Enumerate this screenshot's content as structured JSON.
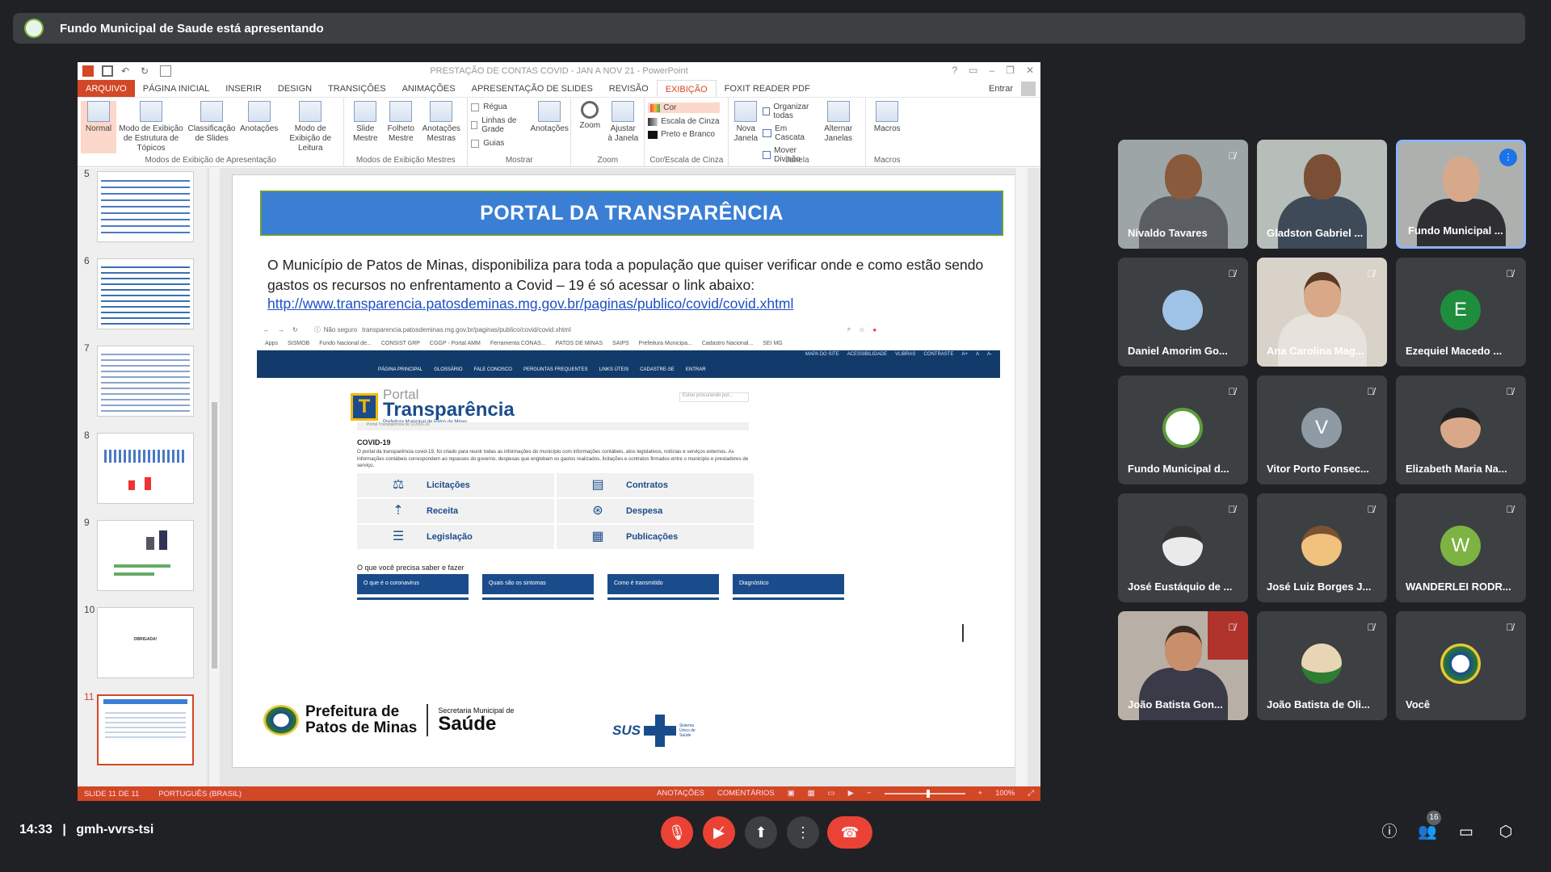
{
  "presenting": {
    "text": "Fundo Municipal de Saude está apresentando"
  },
  "ppt": {
    "window_title": "PRESTAÇÃO DE CONTAS COVID - JAN A NOV 21 - PowerPoint",
    "window_controls": [
      "?",
      "▭",
      "–",
      "❐",
      "✕"
    ],
    "signin": "Entrar",
    "tabs": [
      "ARQUIVO",
      "PÁGINA INICIAL",
      "INSERIR",
      "DESIGN",
      "TRANSIÇÕES",
      "ANIMAÇÕES",
      "APRESENTAÇÃO DE SLIDES",
      "REVISÃO",
      "EXIBIÇÃO",
      "FOXIT READER PDF"
    ],
    "ribbon": {
      "views": [
        "Normal",
        "Modo de Exibição de Estrutura de Tópicos",
        "Classificação de Slides",
        "Anotações",
        "Modo de Exibição de Leitura"
      ],
      "views_label": "Modos de Exibição de Apresentação",
      "masters": [
        "Slide Mestre",
        "Folheto Mestre",
        "Anotações Mestras"
      ],
      "masters_label": "Modos de Exibição Mestres",
      "show": [
        "Régua",
        "Linhas de Grade",
        "Guias"
      ],
      "show_notes": "Anotações",
      "show_label": "Mostrar",
      "zoom": [
        "Zoom",
        "Ajustar à Janela"
      ],
      "zoom_label": "Zoom",
      "color": [
        "Cor",
        "Escala de Cinza",
        "Preto e Branco"
      ],
      "color_label": "Cor/Escala de Cinza",
      "window_new": "Nova Janela",
      "window_opts": [
        "Organizar todas",
        "Em Cascata",
        "Mover Divisão"
      ],
      "window_switch": "Alternar Janelas",
      "window_label": "Janela",
      "macros": "Macros",
      "macros_label": "Macros"
    },
    "thumb_numbers": [
      "5",
      "6",
      "7",
      "8",
      "9",
      "10",
      "11"
    ],
    "thumb10_text": "OBRIGADA!",
    "status": {
      "slide": "SLIDE 11 DE 11",
      "lang": "PORTUGUÊS (BRASIL)",
      "notes": "ANOTAÇÕES",
      "comments": "COMENTÁRIOS",
      "zoom": "100%"
    }
  },
  "slide": {
    "title": "PORTAL DA TRANSPARÊNCIA",
    "text": "O Município de Patos de Minas, disponibiliza para toda a população que quiser verificar onde e como estão sendo gastos os recursos no enfrentamento a Covid – 19 é só acessar o link abaixo:",
    "link": "http://www.transparencia.patosdeminas.mg.gov.br/paginas/publico/covid/covid.xhtml",
    "browser": {
      "not_secure": "Não seguro",
      "url": "transparencia.patosdeminas.mg.gov.br/paginas/publico/covid/covid.xhtml",
      "bookmarks": [
        "Apps",
        "SISMOB",
        "Fundo Nacional de...",
        "CONSIST GRP",
        "CGGP - Portal AMM",
        "Ferramenta CONAS...",
        "PATOS DE MINAS",
        "SAIPS",
        "Prefeitura Municipa...",
        "Cadastro Nacional...",
        "SEI MG"
      ],
      "topnav_right": [
        "MAPA DO SITE",
        "ACESSIBILIDADE",
        "VLIBRAS",
        "CONTRASTE",
        "A+",
        "A",
        "A-"
      ],
      "topnav": [
        "PÁGINA PRINCIPAL",
        "GLOSSÁRIO",
        "FALE CONOSCO",
        "PERGUNTAS FREQUENTES",
        "LINKS ÚTEIS",
        "CADASTRE-SE",
        "ENTRAR"
      ],
      "logo_top": "Portal",
      "logo_main": "Transparência",
      "logo_sub": "Prefeitura Municipal de Patos de Minas",
      "search": "Estou procurando por...",
      "crumb": "Portal Transparência de COVID-19",
      "heading": "COVID-19",
      "para": "O portal da transparência covid-19, foi criado para reunir todas as informações do município com informações contábeis, atos legislativos, notícias e serviços externos. As informações contábeis correspondem ao repasses do governo, despesas que englobam os gastos realizados, licitações e contratos firmados entre o município e prestadores de serviço.",
      "tiles": [
        "Licitações",
        "Contratos",
        "Receita",
        "Despesa",
        "Legislação",
        "Publicações"
      ],
      "sub": "O que você precisa saber e fazer",
      "buttons": [
        "O que é o coronavirus",
        "Quais são os sintomas",
        "Como é transmitido",
        "Diagnóstico"
      ]
    },
    "footer": {
      "pref1": "Prefeitura de",
      "pref2": "Patos de Minas",
      "sec1": "Secretaria Municipal de",
      "sec2": "Saúde",
      "sus": "SUS",
      "sus_sub": "Sistema Único de Saúde"
    }
  },
  "participants": [
    {
      "name": "Nivaldo Tavares"
    },
    {
      "name": "Gladston Gabriel ..."
    },
    {
      "name": "Fundo Municipal ..."
    },
    {
      "name": "Daniel Amorim Go..."
    },
    {
      "name": "Ana Carolina Mag..."
    },
    {
      "name": "Ezequiel Macedo ...",
      "initial": "E"
    },
    {
      "name": "Fundo Municipal d..."
    },
    {
      "name": "Vitor Porto Fonsec...",
      "initial": "V"
    },
    {
      "name": "Elizabeth Maria Na..."
    },
    {
      "name": "José Eustáquio de ..."
    },
    {
      "name": "José Luiz Borges J..."
    },
    {
      "name": "WANDERLEI RODR...",
      "initial": "W"
    },
    {
      "name": "João Batista Gon..."
    },
    {
      "name": "João Batista de Oli..."
    },
    {
      "name": "Você"
    }
  ],
  "meeting": {
    "time": "14:33",
    "separator": "|",
    "code": "gmh-vvrs-tsi",
    "people_count": "16"
  },
  "colors": {
    "ppt_accent": "#d24726",
    "meet_bg": "#202124",
    "hangup": "#ea4335",
    "slide_banner": "#3b7fd4",
    "portal_blue": "#1a4c8c"
  }
}
